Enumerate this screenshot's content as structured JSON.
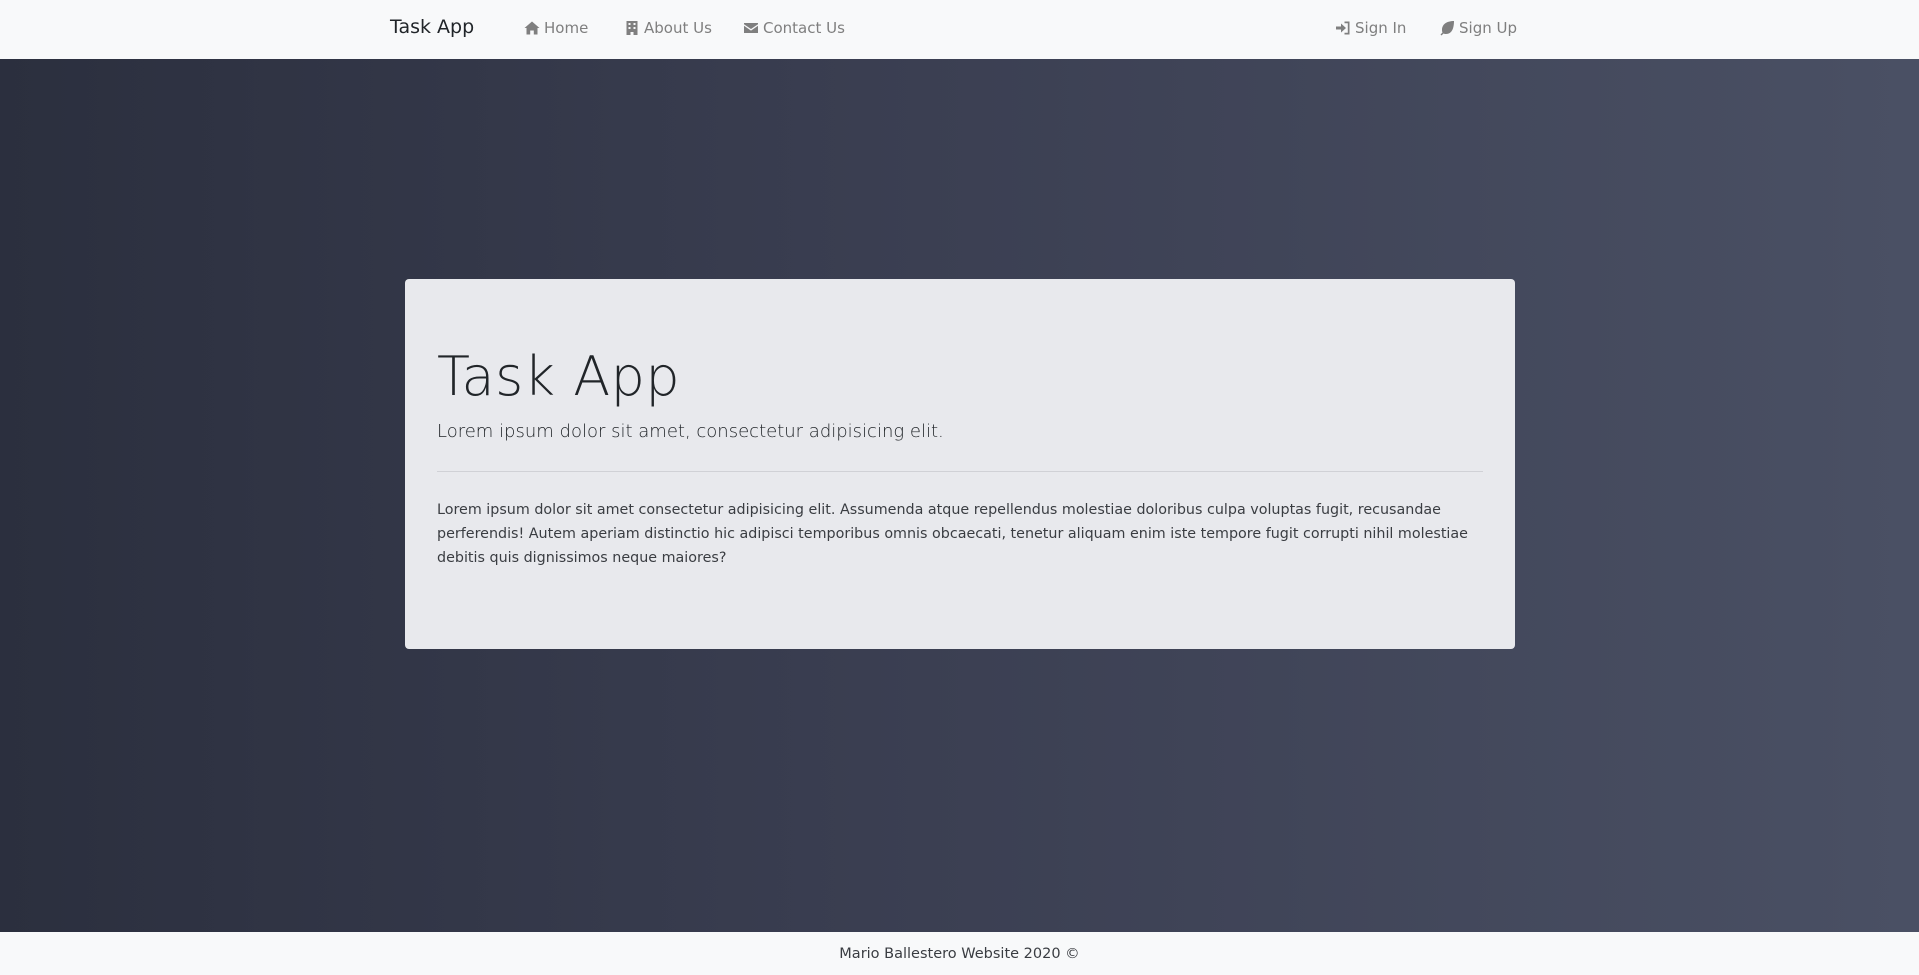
{
  "navbar": {
    "brand": "Task App",
    "links_left": [
      {
        "label": "Home",
        "icon": "home-icon"
      },
      {
        "label": "About Us",
        "icon": "building-icon"
      },
      {
        "label": "Contact Us",
        "icon": "envelope-icon"
      }
    ],
    "links_right": [
      {
        "label": "Sign In",
        "icon": "sign-in-icon"
      },
      {
        "label": "Sign Up",
        "icon": "leaf-icon"
      }
    ]
  },
  "jumbotron": {
    "title": "Task App",
    "lead": "Lorem ipsum dolor sit amet, consectetur adipisicing elit.",
    "body": "Lorem ipsum dolor sit amet consectetur adipisicing elit. Assumenda atque repellendus molestiae doloribus culpa voluptas fugit, recusandae perferendis! Autem aperiam distinctio hic adipisci temporibus omnis obcaecati, tenetur aliquam enim iste tempore fugit corrupti nihil molestiae debitis quis dignissimos neque maiores?"
  },
  "footer": {
    "text": "Mario Ballestero Website 2020 ©"
  },
  "colors": {
    "navbar_bg": "#f8f9fa",
    "hero_gradient_start": "#2b2f3e",
    "hero_gradient_end": "#4a5064",
    "card_bg": "#e8e9ed",
    "link": "#7f7f7f"
  }
}
